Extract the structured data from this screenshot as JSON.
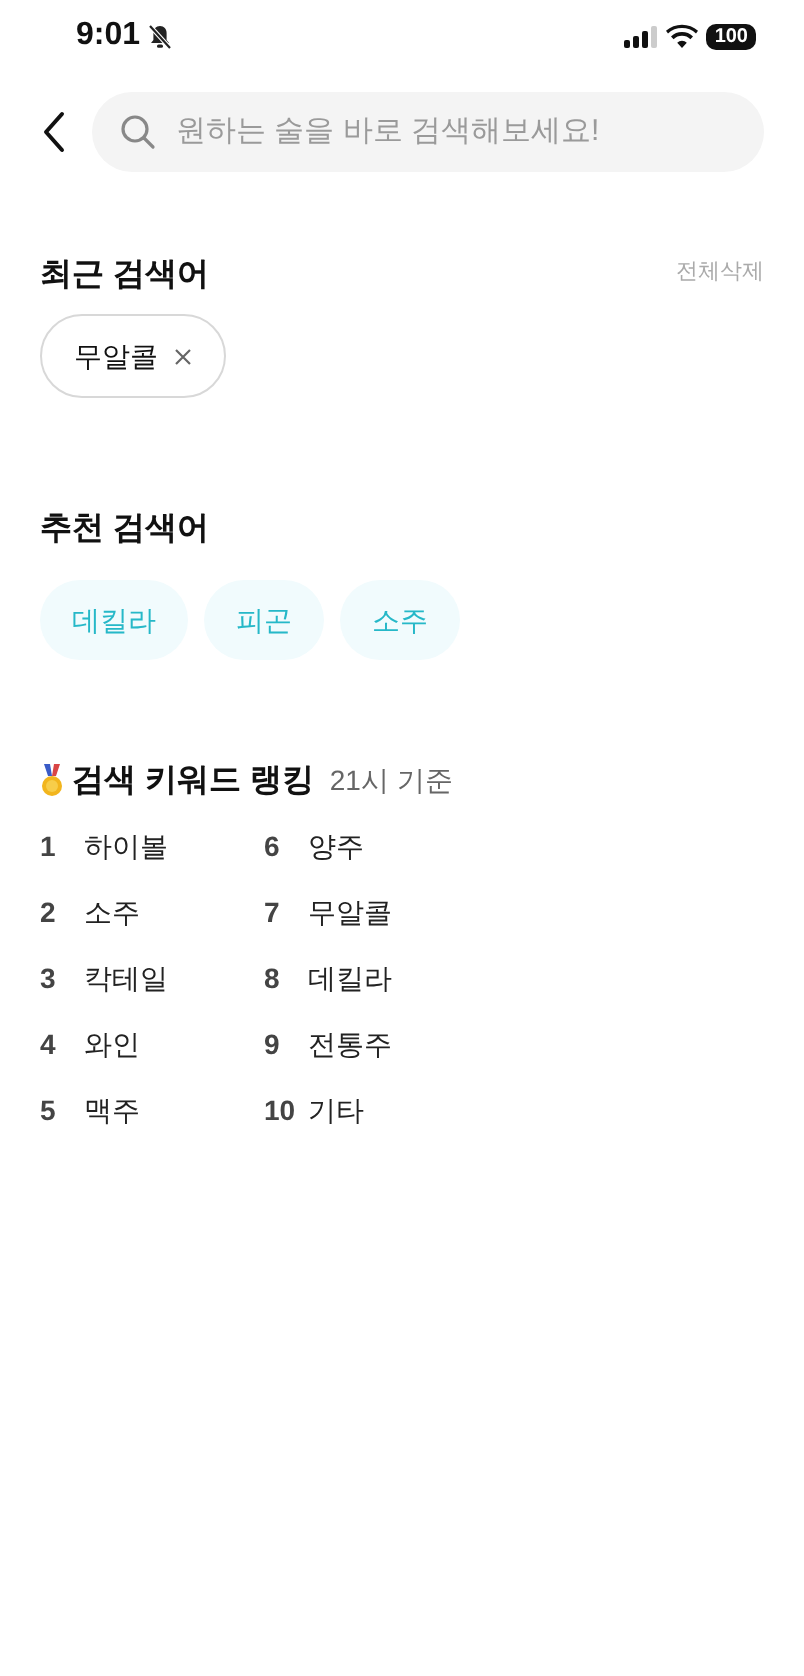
{
  "status_bar": {
    "time": "9:01",
    "battery": "100"
  },
  "search": {
    "placeholder": "원하는 술을 바로 검색해보세요!"
  },
  "recent": {
    "title": "최근 검색어",
    "clear_label": "전체삭제",
    "items": [
      {
        "label": "무알콜"
      }
    ]
  },
  "recommended": {
    "title": "추천 검색어",
    "items": [
      {
        "label": "데킬라"
      },
      {
        "label": "피곤"
      },
      {
        "label": "소주"
      }
    ]
  },
  "ranking": {
    "title": "검색 키워드 랭킹",
    "basis": "21시 기준",
    "items": [
      {
        "rank": "1",
        "label": "하이볼"
      },
      {
        "rank": "2",
        "label": "소주"
      },
      {
        "rank": "3",
        "label": "칵테일"
      },
      {
        "rank": "4",
        "label": "와인"
      },
      {
        "rank": "5",
        "label": "맥주"
      },
      {
        "rank": "6",
        "label": "양주"
      },
      {
        "rank": "7",
        "label": "무알콜"
      },
      {
        "rank": "8",
        "label": "데킬라"
      },
      {
        "rank": "9",
        "label": "전통주"
      },
      {
        "rank": "10",
        "label": "기타"
      }
    ]
  }
}
